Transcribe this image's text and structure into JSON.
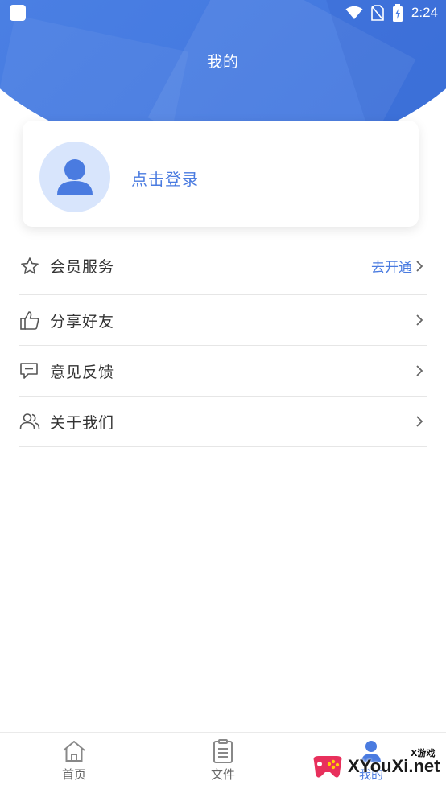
{
  "status_bar": {
    "time": "2:24"
  },
  "header": {
    "title": "我的"
  },
  "login_card": {
    "login_text": "点击登录"
  },
  "menu": {
    "items": [
      {
        "label": "会员服务",
        "extra": "去开通",
        "icon": "star-icon"
      },
      {
        "label": "分享好友",
        "extra": "",
        "icon": "thumbs-up-icon"
      },
      {
        "label": "意见反馈",
        "extra": "",
        "icon": "feedback-icon"
      },
      {
        "label": "关于我们",
        "extra": "",
        "icon": "users-icon"
      }
    ]
  },
  "tabbar": {
    "tabs": [
      {
        "label": "首页",
        "icon": "home-icon"
      },
      {
        "label": "文件",
        "icon": "clipboard-icon"
      },
      {
        "label": "我的",
        "icon": "user-icon"
      }
    ]
  },
  "watermark": {
    "text": "XYouXi.net",
    "small": "X游戏"
  },
  "colors": {
    "primary": "#4a7fe3",
    "accent_text": "#4a7be0",
    "avatar_bg": "#d8e5fc"
  }
}
